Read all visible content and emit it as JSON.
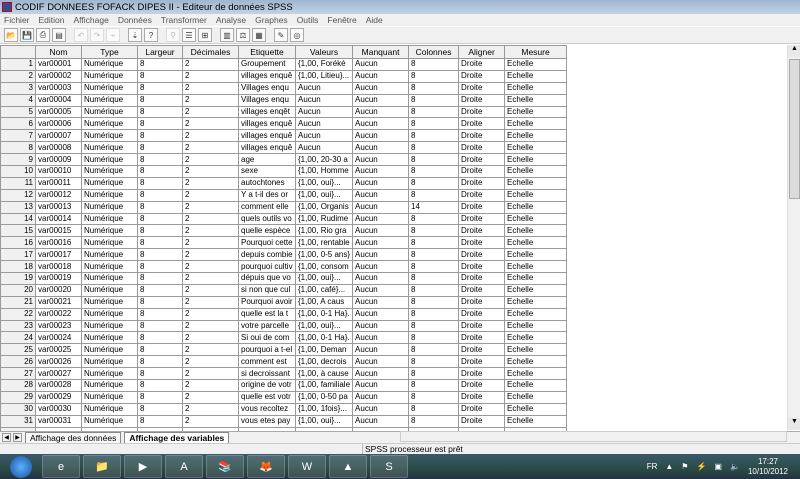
{
  "window": {
    "title": "CODIF DONNEES FOFACK DIPES II - Editeur de données SPSS"
  },
  "menu": [
    "Fichier",
    "Edition",
    "Affichage",
    "Données",
    "Transformer",
    "Analyse",
    "Graphes",
    "Outils",
    "Fenêtre",
    "Aide"
  ],
  "toolbar": [
    "open-icon",
    "save-icon",
    "print-icon",
    "dialog-recall-icon",
    "undo-icon",
    "redo-icon",
    "goto-chart-icon",
    "goto-case-icon",
    "variables-icon",
    "find-icon",
    "insert-case-icon",
    "insert-variable-icon",
    "split-file-icon",
    "weight-cases-icon",
    "select-cases-icon",
    "value-labels-icon",
    "use-sets-icon"
  ],
  "columns": [
    "Nom",
    "Type",
    "Largeur",
    "Décimales",
    "Etiquette",
    "Valeurs",
    "Manquant",
    "Colonnes",
    "Aligner",
    "Mesure"
  ],
  "rows": [
    [
      "var00001",
      "Numérique",
      "8",
      "2",
      "Groupement",
      "{1,00, Foréké",
      "Aucun",
      "8",
      "Droite",
      "Echelle"
    ],
    [
      "var00002",
      "Numérique",
      "8",
      "2",
      "villages enquê",
      "{1,00, Litieu}...",
      "Aucun",
      "8",
      "Droite",
      "Echelle"
    ],
    [
      "var00003",
      "Numérique",
      "8",
      "2",
      "Villages enqu",
      "Aucun",
      "Aucun",
      "8",
      "Droite",
      "Echelle"
    ],
    [
      "var00004",
      "Numérique",
      "8",
      "2",
      "Villages enqu",
      "Aucun",
      "Aucun",
      "8",
      "Droite",
      "Echelle"
    ],
    [
      "var00005",
      "Numérique",
      "8",
      "2",
      "villages enqêt",
      "Aucun",
      "Aucun",
      "8",
      "Droite",
      "Echelle"
    ],
    [
      "var00006",
      "Numérique",
      "8",
      "2",
      "villages enquê",
      "Aucun",
      "Aucun",
      "8",
      "Droite",
      "Echelle"
    ],
    [
      "var00007",
      "Numérique",
      "8",
      "2",
      "villages enquê",
      "Aucun",
      "Aucun",
      "8",
      "Droite",
      "Echelle"
    ],
    [
      "var00008",
      "Numérique",
      "8",
      "2",
      "villages enquê",
      "Aucun",
      "Aucun",
      "8",
      "Droite",
      "Echelle"
    ],
    [
      "var00009",
      "Numérique",
      "8",
      "2",
      "age",
      "{1,00, 20-30 a",
      "Aucun",
      "8",
      "Droite",
      "Echelle"
    ],
    [
      "var00010",
      "Numérique",
      "8",
      "2",
      "sexe",
      "{1,00, Homme",
      "Aucun",
      "8",
      "Droite",
      "Echelle"
    ],
    [
      "var00011",
      "Numérique",
      "8",
      "2",
      "autochtones",
      "{1,00, oui}...",
      "Aucun",
      "8",
      "Droite",
      "Echelle"
    ],
    [
      "var00012",
      "Numérique",
      "8",
      "2",
      "Y a t-il des or",
      "{1,00, oui}...",
      "Aucun",
      "8",
      "Droite",
      "Echelle"
    ],
    [
      "var00013",
      "Numérique",
      "8",
      "2",
      "comment elle",
      "{1,00, Organis",
      "Aucun",
      "14",
      "Droite",
      "Echelle"
    ],
    [
      "var00014",
      "Numérique",
      "8",
      "2",
      "quels outils vo",
      "{1,00, Rudime",
      "Aucun",
      "8",
      "Droite",
      "Echelle"
    ],
    [
      "var00015",
      "Numérique",
      "8",
      "2",
      "quelle espèce",
      "{1,00, Rio gra",
      "Aucun",
      "8",
      "Droite",
      "Echelle"
    ],
    [
      "var00016",
      "Numérique",
      "8",
      "2",
      "Pourquoi cette",
      "{1,00, rentable",
      "Aucun",
      "8",
      "Droite",
      "Echelle"
    ],
    [
      "var00017",
      "Numérique",
      "8",
      "2",
      "depuis combie",
      "{1,00, 0-5 ans}",
      "Aucun",
      "8",
      "Droite",
      "Echelle"
    ],
    [
      "var00018",
      "Numérique",
      "8",
      "2",
      "pourquoi cultiv",
      "{1,00, consom",
      "Aucun",
      "8",
      "Droite",
      "Echelle"
    ],
    [
      "var00019",
      "Numérique",
      "8",
      "2",
      "dépuis que vo",
      "{1,00, oui}...",
      "Aucun",
      "8",
      "Droite",
      "Echelle"
    ],
    [
      "var00020",
      "Numérique",
      "8",
      "2",
      "si non que cul",
      "{1,00, café}...",
      "Aucun",
      "8",
      "Droite",
      "Echelle"
    ],
    [
      "var00021",
      "Numérique",
      "8",
      "2",
      "Pourquoi avoir",
      "{1,00, A caus",
      "Aucun",
      "8",
      "Droite",
      "Echelle"
    ],
    [
      "var00022",
      "Numérique",
      "8",
      "2",
      "quelle est la t",
      "{1,00, 0-1 Ha}.",
      "Aucun",
      "8",
      "Droite",
      "Echelle"
    ],
    [
      "var00023",
      "Numérique",
      "8",
      "2",
      "votre parcelle",
      "{1,00, oui}...",
      "Aucun",
      "8",
      "Droite",
      "Echelle"
    ],
    [
      "var00024",
      "Numérique",
      "8",
      "2",
      "Si oui de com",
      "{1,00, 0-1 Ha}.",
      "Aucun",
      "8",
      "Droite",
      "Echelle"
    ],
    [
      "var00025",
      "Numérique",
      "8",
      "2",
      "pourquoi a t-el",
      "{1,00,  Deman",
      "Aucun",
      "8",
      "Droite",
      "Echelle"
    ],
    [
      "var00026",
      "Numérique",
      "8",
      "2",
      "comment est",
      "{1,00,  decrois",
      "Aucun",
      "8",
      "Droite",
      "Echelle"
    ],
    [
      "var00027",
      "Numérique",
      "8",
      "2",
      "si decroissant",
      "{1,00, à cause",
      "Aucun",
      "8",
      "Droite",
      "Echelle"
    ],
    [
      "var00028",
      "Numérique",
      "8",
      "2",
      "origine de votr",
      "{1,00, familiale",
      "Aucun",
      "8",
      "Droite",
      "Echelle"
    ],
    [
      "var00029",
      "Numérique",
      "8",
      "2",
      "quelle est votr",
      "{1,00, 0-50 pa",
      "Aucun",
      "8",
      "Droite",
      "Echelle"
    ],
    [
      "var00030",
      "Numérique",
      "8",
      "2",
      "vous recoltez",
      "{1,00, 1fois}...",
      "Aucun",
      "8",
      "Droite",
      "Echelle"
    ],
    [
      "var00031",
      "Numérique",
      "8",
      "2",
      "vous etes pay",
      "{1,00, oui}...",
      "Aucun",
      "8",
      "Droite",
      "Echelle"
    ]
  ],
  "tabs": [
    "Affichage des données",
    "Affichage des variables"
  ],
  "status": "SPSS processeur  est prêt",
  "taskbar": {
    "apps": [
      "internet-explorer-icon",
      "file-explorer-icon",
      "media-player-icon",
      "acrobat-icon",
      "books-icon",
      "firefox-icon",
      "word-icon",
      "vlc-icon",
      "spss-icon"
    ],
    "lang": "FR",
    "time": "17:27",
    "date": "10/10/2012"
  }
}
